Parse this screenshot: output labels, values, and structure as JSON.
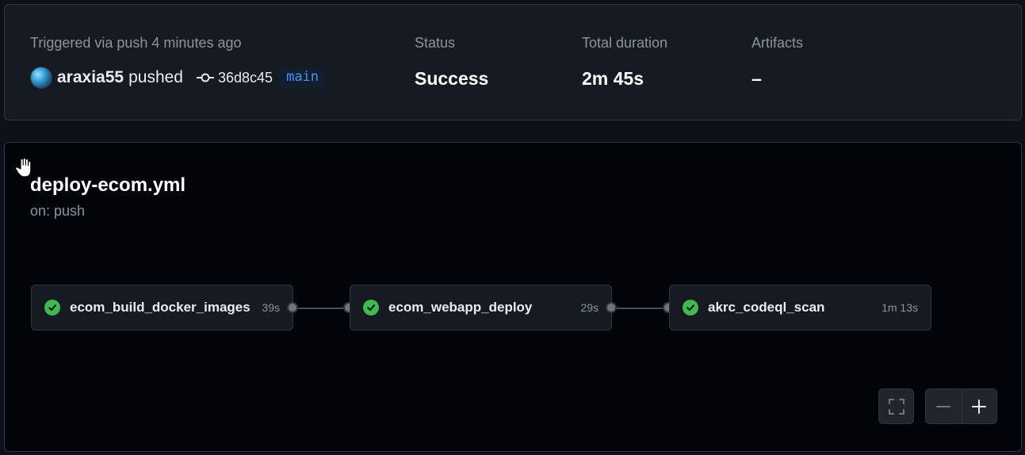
{
  "summary": {
    "trigger_label": "Triggered via push 4 minutes ago",
    "actor": "araxia55",
    "action": "pushed",
    "commit_sha": "36d8c45",
    "branch": "main",
    "status_label": "Status",
    "status_value": "Success",
    "duration_label": "Total duration",
    "duration_value": "2m 45s",
    "artifacts_label": "Artifacts",
    "artifacts_value": "–"
  },
  "workflow": {
    "file": "deploy-ecom.yml",
    "trigger": "on: push"
  },
  "jobs": [
    {
      "name": "ecom_build_docker_images",
      "duration": "39s",
      "status": "success"
    },
    {
      "name": "ecom_webapp_deploy",
      "duration": "29s",
      "status": "success"
    },
    {
      "name": "akrc_codeql_scan",
      "duration": "1m 13s",
      "status": "success"
    }
  ],
  "controls": {
    "fullscreen_icon": "fullscreen-icon",
    "zoom_out_icon": "zoom-out-icon",
    "zoom_in_icon": "zoom-in-icon"
  },
  "colors": {
    "success": "#3fb950",
    "branch": "#4493f8",
    "panel_bg": "#010409",
    "card_bg": "#161b22"
  }
}
